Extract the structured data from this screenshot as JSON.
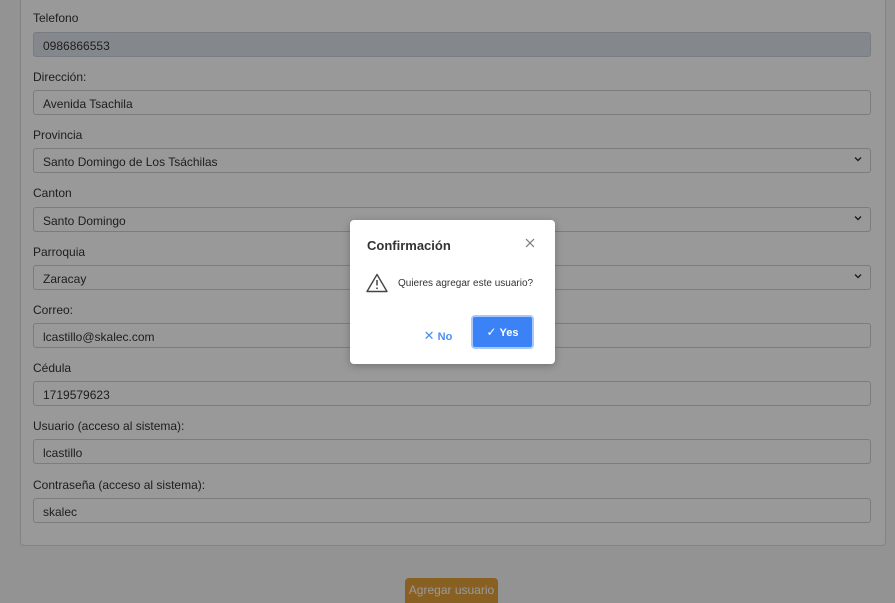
{
  "form": {
    "fields": [
      {
        "label": "Telefono",
        "value": "0986866553"
      },
      {
        "label": "Dirección:",
        "value": "Avenida Tsachila"
      },
      {
        "label": "Provincia",
        "value": "Santo Domingo de Los Tsáchilas"
      },
      {
        "label": "Canton",
        "value": "Santo Domingo"
      },
      {
        "label": "Parroquia",
        "value": "Zaracay"
      },
      {
        "label": "Correo:",
        "value": "lcastillo@skalec.com"
      },
      {
        "label": "Cédula",
        "value": "1719579623"
      },
      {
        "label": "Usuario (acceso al sistema):",
        "value": "lcastillo"
      },
      {
        "label": "Contraseña (acceso al sistema):",
        "value": "skalec"
      }
    ],
    "submit_label": "Agregar usuario"
  },
  "dialog": {
    "title": "Confirmación",
    "message": "Quieres agregar este usuario?",
    "no_label": "No",
    "yes_label": "Yes",
    "icons": {
      "close": "close-icon",
      "warning": "warning-icon",
      "no": "x-icon",
      "yes": "check-icon"
    }
  },
  "colors": {
    "accent": "#3b82f6",
    "submit": "#e3a03a",
    "filled_field": "#dde3ec"
  }
}
